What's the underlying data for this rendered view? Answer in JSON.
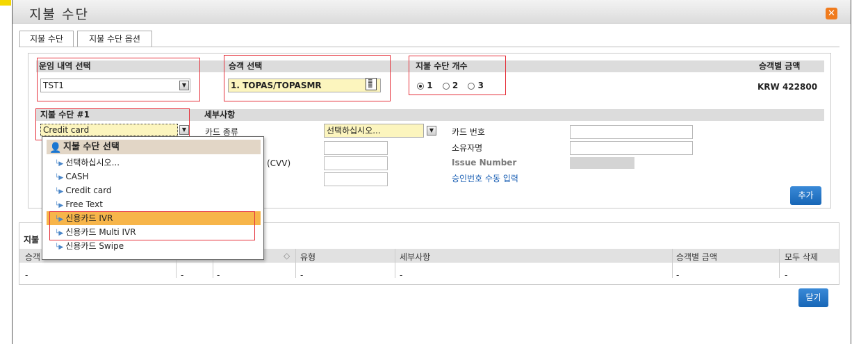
{
  "window": {
    "title": "지불 수단"
  },
  "tabs": [
    {
      "label": "지불 수단"
    },
    {
      "label": "지불 수단 옵션"
    }
  ],
  "top_section": {
    "fare": {
      "header": "운임 내역 선택",
      "value": "TST1"
    },
    "passenger": {
      "header": "승객 선택",
      "value": "1. TOPAS/TOPASMR"
    },
    "fop_count": {
      "header": "지불 수단 개수",
      "options": [
        "1",
        "2",
        "3"
      ],
      "selected": "1"
    },
    "amount": {
      "header": "승객별 금액",
      "value": "KRW 422800"
    }
  },
  "fop1": {
    "header": "지불 수단 #1",
    "value": "Credit card"
  },
  "details": {
    "header": "세부사항",
    "card_type_label": "카드 종류",
    "card_type_value": "선택하십시오...",
    "cvv_label_tail": "(CVV)",
    "card_number_label": "카드 번호",
    "owner_label": "소유자명",
    "issue_number_label": "Issue Number",
    "manual_auth_link": "승인번호 수동 입력",
    "add_button": "추가"
  },
  "dropdown": {
    "title": "지불 수단 선택",
    "items": [
      {
        "label": "선택하십시오..."
      },
      {
        "label": "CASH"
      },
      {
        "label": "Credit card"
      },
      {
        "label": "Free Text"
      },
      {
        "label": "신용카드 IVR"
      },
      {
        "label": "신용카드 Multi IVR"
      },
      {
        "label": "신용카드 Swipe"
      }
    ],
    "highlighted": "신용카드 IVR"
  },
  "grid": {
    "section_title": "지불",
    "columns": {
      "passenger": "승객",
      "type": "유형",
      "details": "세부사항",
      "amount": "승객별 금액",
      "delete_all": "모두 삭제"
    },
    "row": {
      "c1": "-",
      "c2": "-",
      "c3": "-",
      "c4": "-",
      "c5": "-",
      "c6": "-",
      "c7": "-"
    }
  },
  "close_button": "닫기",
  "colors": {
    "accent_blue": "#1766b6",
    "highlight_orange": "#f7b54a",
    "red_outline": "#e5303a",
    "input_yellow": "#fcf5be",
    "close_orange": "#f07b1d"
  }
}
